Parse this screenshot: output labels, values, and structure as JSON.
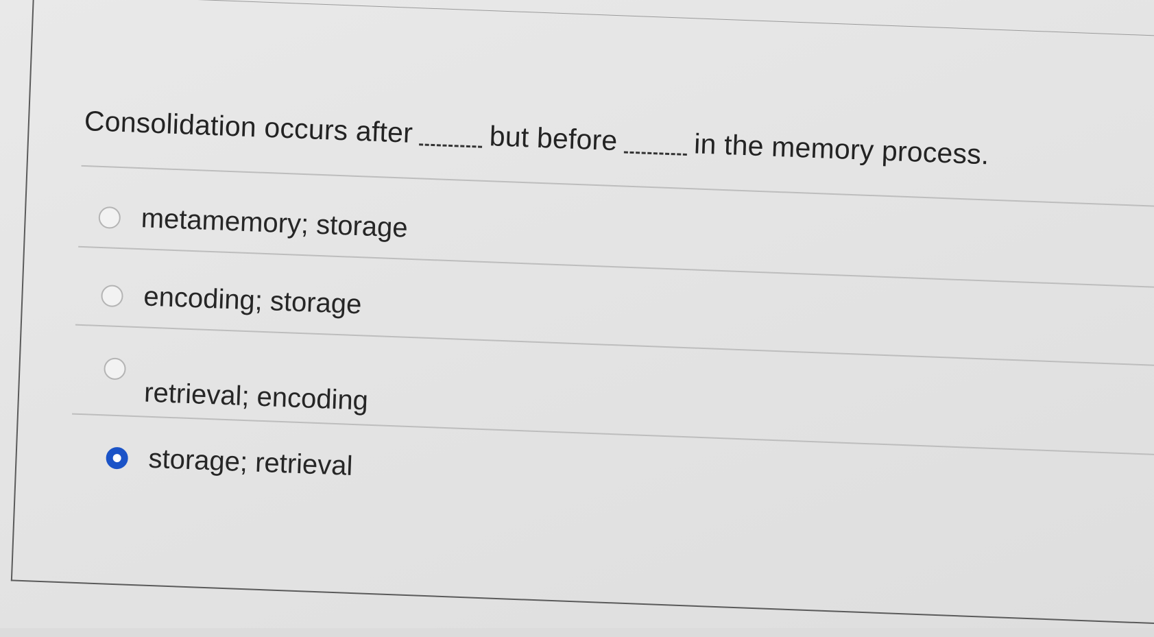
{
  "question": {
    "before_first_blank": "Consolidation occurs after",
    "between_blanks": "but before",
    "after_second_blank": "in the memory process."
  },
  "options": [
    {
      "label": "metamemory; storage",
      "selected": false
    },
    {
      "label": "encoding; storage",
      "selected": false
    },
    {
      "label": "retrieval; encoding",
      "selected": false
    },
    {
      "label": "storage; retrieval",
      "selected": true
    }
  ],
  "colors": {
    "selected_radio": "#1b53c7",
    "background": "#e4e4e4"
  }
}
